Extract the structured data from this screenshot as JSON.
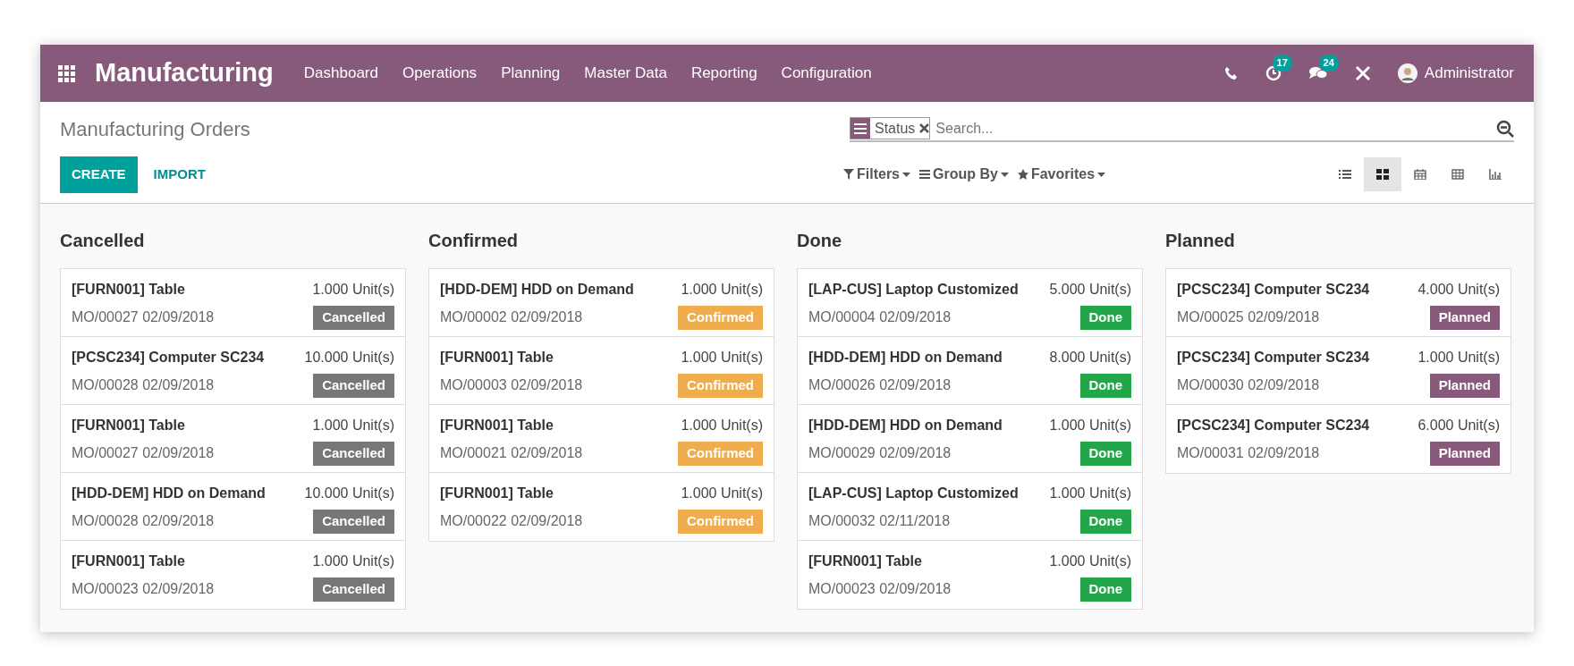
{
  "navbar": {
    "app_title": "Manufacturing",
    "menu": [
      "Dashboard",
      "Operations",
      "Planning",
      "Master Data",
      "Reporting",
      "Configuration"
    ],
    "activity_count": "17",
    "message_count": "24",
    "user": "Administrator"
  },
  "control_panel": {
    "breadcrumb": "Manufacturing Orders",
    "buttons": [
      "CREATE",
      "IMPORT"
    ],
    "search": {
      "facet": "Status",
      "placeholder": "Search..."
    },
    "search_options": [
      "Filters",
      "Group By",
      "Favorites"
    ],
    "views": [
      {
        "kind": "list",
        "selected": false
      },
      {
        "kind": "kanban",
        "selected": true
      },
      {
        "kind": "calendar",
        "selected": false
      },
      {
        "kind": "pivot",
        "selected": false
      },
      {
        "kind": "graph",
        "selected": false
      }
    ]
  },
  "columns": [
    {
      "title": "Cancelled",
      "cards": [
        {
          "product": "[FURN001] Table",
          "quantity": "1.000 Unit(s)",
          "reference": "MO/00027 02/09/2018",
          "status": "Cancelled",
          "color": "#777777"
        },
        {
          "product": "[PCSC234] Computer SC234",
          "quantity": "10.000 Unit(s)",
          "reference": "MO/00028 02/09/2018",
          "status": "Cancelled",
          "color": "#777777"
        },
        {
          "product": "[FURN001] Table",
          "quantity": "1.000 Unit(s)",
          "reference": "MO/00027 02/09/2018",
          "status": "Cancelled",
          "color": "#777777"
        },
        {
          "product": "[HDD-DEM] HDD on Demand",
          "quantity": "10.000 Unit(s)",
          "reference": "MO/00028 02/09/2018",
          "status": "Cancelled",
          "color": "#777777"
        },
        {
          "product": "[FURN001] Table",
          "quantity": "1.000 Unit(s)",
          "reference": "MO/00023 02/09/2018",
          "status": "Cancelled",
          "color": "#777777"
        }
      ]
    },
    {
      "title": "Confirmed",
      "cards": [
        {
          "product": "[HDD-DEM] HDD on Demand",
          "quantity": "1.000 Unit(s)",
          "reference": "MO/00002 02/09/2018",
          "status": "Confirmed",
          "color": "#f0ad4e"
        },
        {
          "product": "[FURN001] Table",
          "quantity": "1.000 Unit(s)",
          "reference": "MO/00003 02/09/2018",
          "status": "Confirmed",
          "color": "#f0ad4e"
        },
        {
          "product": "[FURN001] Table",
          "quantity": "1.000 Unit(s)",
          "reference": "MO/00021 02/09/2018",
          "status": "Confirmed",
          "color": "#f0ad4e"
        },
        {
          "product": "[FURN001] Table",
          "quantity": "1.000 Unit(s)",
          "reference": "MO/00022 02/09/2018",
          "status": "Confirmed",
          "color": "#f0ad4e"
        }
      ]
    },
    {
      "title": "Done",
      "cards": [
        {
          "product": "[LAP-CUS] Laptop Customized",
          "quantity": "5.000 Unit(s)",
          "reference": "MO/00004 02/09/2018",
          "status": "Done",
          "color": "#21a649"
        },
        {
          "product": "[HDD-DEM] HDD on Demand",
          "quantity": "8.000 Unit(s)",
          "reference": "MO/00026 02/09/2018",
          "status": "Done",
          "color": "#21a649"
        },
        {
          "product": "[HDD-DEM] HDD on Demand",
          "quantity": "1.000 Unit(s)",
          "reference": "MO/00029 02/09/2018",
          "status": "Done",
          "color": "#21a649"
        },
        {
          "product": "[LAP-CUS] Laptop Customized",
          "quantity": "1.000 Unit(s)",
          "reference": "MO/00032 02/11/2018",
          "status": "Done",
          "color": "#21a649"
        },
        {
          "product": "[FURN001] Table",
          "quantity": "1.000 Unit(s)",
          "reference": "MO/00023 02/09/2018",
          "status": "Done",
          "color": "#21a649"
        }
      ]
    },
    {
      "title": "Planned",
      "cards": [
        {
          "product": "[PCSC234] Computer SC234",
          "quantity": "4.000 Unit(s)",
          "reference": "MO/00025 02/09/2018",
          "status": "Planned",
          "color": "#875a7b"
        },
        {
          "product": "[PCSC234] Computer SC234",
          "quantity": "1.000 Unit(s)",
          "reference": "MO/00030 02/09/2018",
          "status": "Planned",
          "color": "#875a7b"
        },
        {
          "product": "[PCSC234] Computer SC234",
          "quantity": "6.000 Unit(s)",
          "reference": "MO/00031 02/09/2018",
          "status": "Planned",
          "color": "#875a7b"
        }
      ]
    }
  ]
}
